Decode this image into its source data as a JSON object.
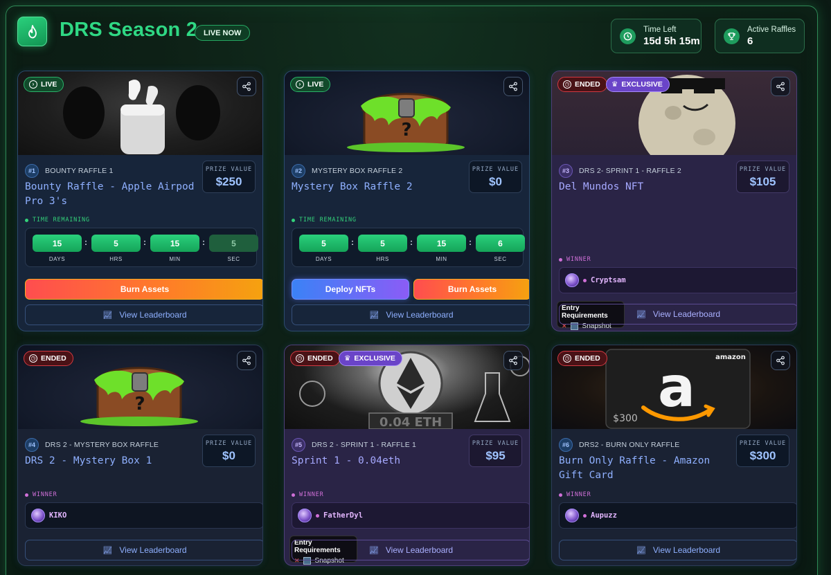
{
  "header": {
    "title": "DRS Season 2",
    "live_badge": "LIVE NOW",
    "time_left_label": "Time Left",
    "time_left_value": "15d 5h 15m",
    "active_raffles_label": "Active Raffles",
    "active_raffles_value": "6"
  },
  "common": {
    "prize_label": "PRIZE VALUE",
    "time_remaining": "TIME REMAINING",
    "winner_label": "WINNER",
    "leaderboard": "View Leaderboard",
    "entry_req_title": "Entry Requirements",
    "entry_req_item": "Snapshot",
    "days": "DAYS",
    "hrs": "HRS",
    "min": "MIN",
    "sec": "SEC"
  },
  "cards": [
    {
      "status": "LIVE",
      "number": "#1",
      "category": "BOUNTY RAFFLE 1",
      "title": "Bounty Raffle - Apple Airpod Pro 3's",
      "prize": "$250",
      "timer": {
        "days": "15",
        "hrs": "5",
        "min": "15",
        "sec": "5"
      },
      "burn_label": "Burn Assets"
    },
    {
      "status": "LIVE",
      "number": "#2",
      "category": "MYSTERY BOX RAFFLE 2",
      "title": "Mystery Box Raffle 2",
      "prize": "$0",
      "timer": {
        "days": "5",
        "hrs": "5",
        "min": "15",
        "sec": "6"
      },
      "deploy_label": "Deploy NFTs",
      "burn_label": "Burn Assets"
    },
    {
      "status": "ENDED",
      "exclusive": "EXCLUSIVE",
      "number": "#3",
      "category": "DRS 2- SPRINT 1 - RAFFLE 2",
      "title": "Del Mundos NFT",
      "prize": "$105",
      "winner": "Cryptsam"
    },
    {
      "status": "ENDED",
      "number": "#4",
      "category": "DRS 2 - MYSTERY BOX RAFFLE",
      "title": "DRS 2 - Mystery Box 1",
      "prize": "$0",
      "winner": "KIKO"
    },
    {
      "status": "ENDED",
      "exclusive": "EXCLUSIVE",
      "number": "#5",
      "category": "DRS 2 - SPRINT 1 - RAFFLE 1",
      "title": "Sprint 1 - 0.04eth",
      "prize": "$95",
      "winner": "FatherDyl",
      "image_text": "0.04 ETH"
    },
    {
      "status": "ENDED",
      "number": "#6",
      "category": "DRS2 - BURN ONLY RAFFLE",
      "title": "Burn Only Raffle - Amazon Gift Card",
      "prize": "$300",
      "winner": "Aupuzz",
      "image_brand": "amazon",
      "image_amount": "$300"
    }
  ],
  "colors": {
    "accent_green": "#2fd884",
    "live_green": "#2bb36a",
    "ended_red": "#d33a42",
    "exclusive_purple": "#6a44c8",
    "link_blue": "#8fb0ff"
  }
}
